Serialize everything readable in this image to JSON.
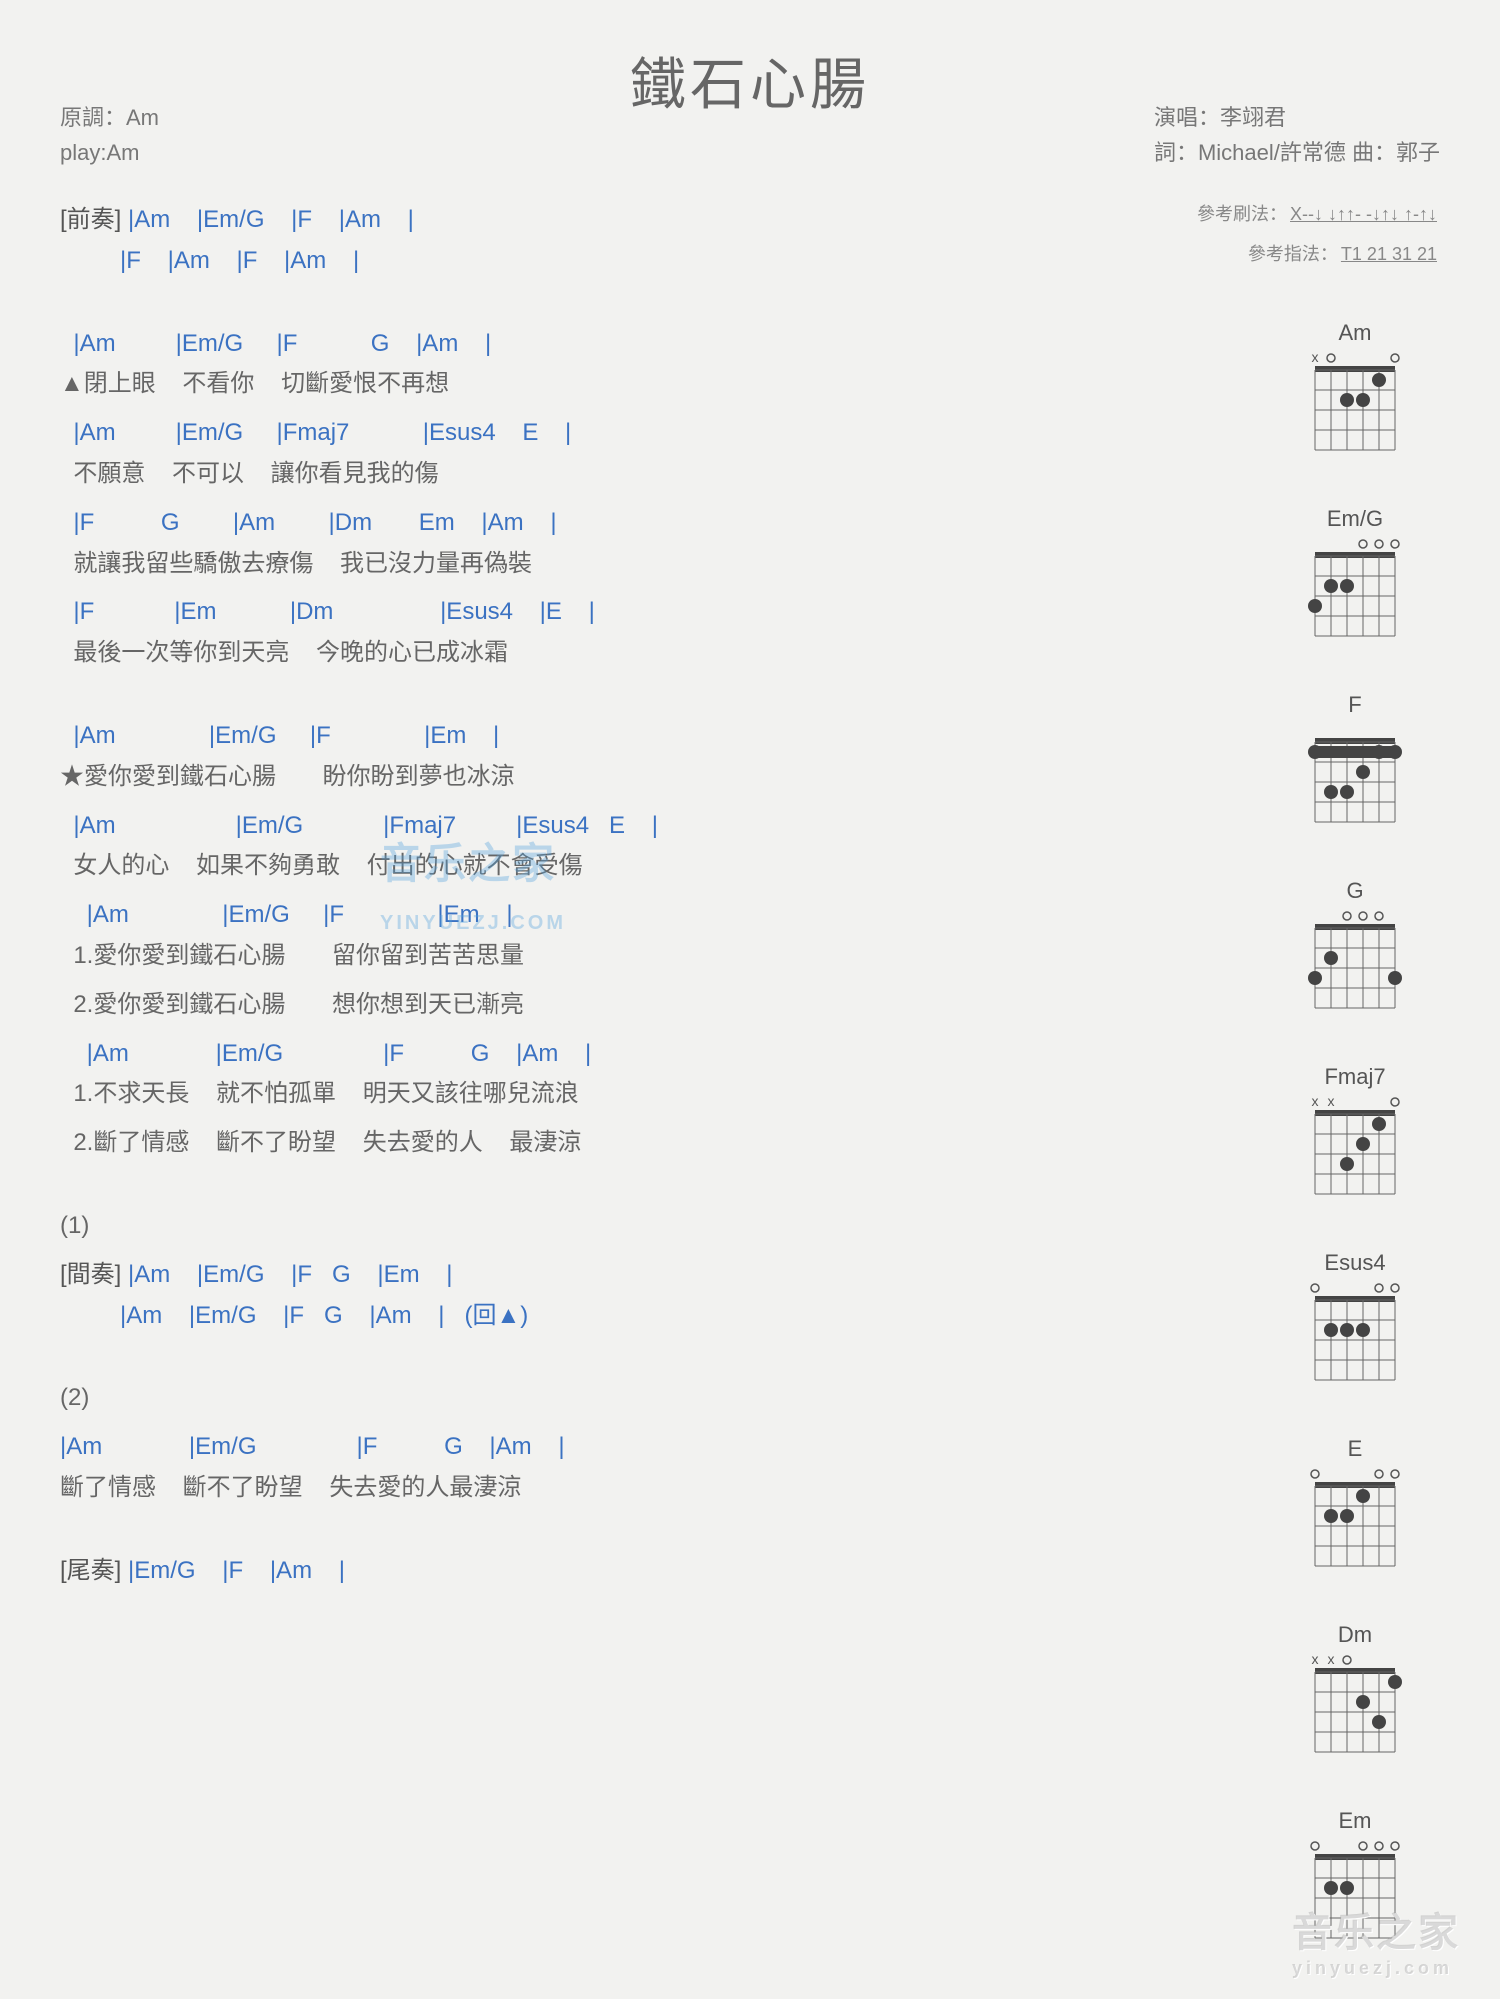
{
  "title": "鐵石心腸",
  "meta_left": {
    "key": "原調：Am",
    "play": "play:Am"
  },
  "meta_right": {
    "singer": "演唱：李翊君",
    "credits": "詞：Michael/許常德  曲：郭子"
  },
  "ref": {
    "strum_label": "參考刷法：",
    "strum": "X--↓ ↓↑↑- -↓↑↓ ↑-↑↓",
    "pick_label": "參考指法：",
    "pick": "T1 21 31 21"
  },
  "intro": {
    "label": "[前奏]",
    "l1": " |Am    |Em/G    |F    |Am    |",
    "l2": "         |F    |Am    |F    |Am    |"
  },
  "verse": {
    "c1": "  |Am         |Em/G     |F           G    |Am    |",
    "l1": "▲閉上眼    不看你    切斷愛恨不再想",
    "c2": "  |Am         |Em/G     |Fmaj7           |Esus4    E    |",
    "l2": "  不願意    不可以    讓你看見我的傷",
    "c3": "  |F          G        |Am        |Dm       Em    |Am    |",
    "l3": "  就讓我留些驕傲去療傷    我已沒力量再偽裝",
    "c4": "  |F            |Em           |Dm                |Esus4    |E    |",
    "l4": "  最後一次等你到天亮    今晚的心已成冰霜"
  },
  "chorus": {
    "c1": "  |Am              |Em/G     |F              |Em    |",
    "l1": "★愛你愛到鐵石心腸       盼你盼到夢也冰涼",
    "c2": "  |Am                  |Em/G            |Fmaj7         |Esus4   E    |",
    "l2": "  女人的心    如果不夠勇敢    付出的心就不會受傷",
    "c3": "    |Am              |Em/G     |F              |Em    |",
    "l3a": "  1.愛你愛到鐵石心腸       留你留到苦苦思量",
    "l3b": "  2.愛你愛到鐵石心腸       想你想到天已漸亮",
    "c4": "    |Am             |Em/G               |F          G    |Am    |",
    "l4a": "  1.不求天長    就不怕孤單    明天又該往哪兒流浪",
    "l4b": "  2.斷了情感    斷不了盼望    失去愛的人    最淒涼"
  },
  "inter": {
    "tag": "(1)",
    "label": "[間奏]",
    "l1": " |Am    |Em/G    |F   G    |Em    |",
    "l2": "         |Am    |Em/G    |F   G    |Am    |   (回▲)"
  },
  "ending": {
    "tag": "(2)",
    "c1": "|Am             |Em/G               |F          G    |Am    |",
    "l1": "斷了情感    斷不了盼望    失去愛的人最淒涼",
    "outro_label": "[尾奏]",
    "outro": " |Em/G    |F    |Am    |"
  },
  "diagrams": [
    "Am",
    "Em/G",
    "F",
    "G",
    "Fmaj7",
    "Esus4",
    "E",
    "Dm",
    "Em"
  ],
  "watermark": {
    "big": "音乐之家",
    "small": "yinyuezj.com"
  },
  "wm_center": {
    "big": "音乐之家",
    "small": "YINYUEZJ.COM"
  }
}
